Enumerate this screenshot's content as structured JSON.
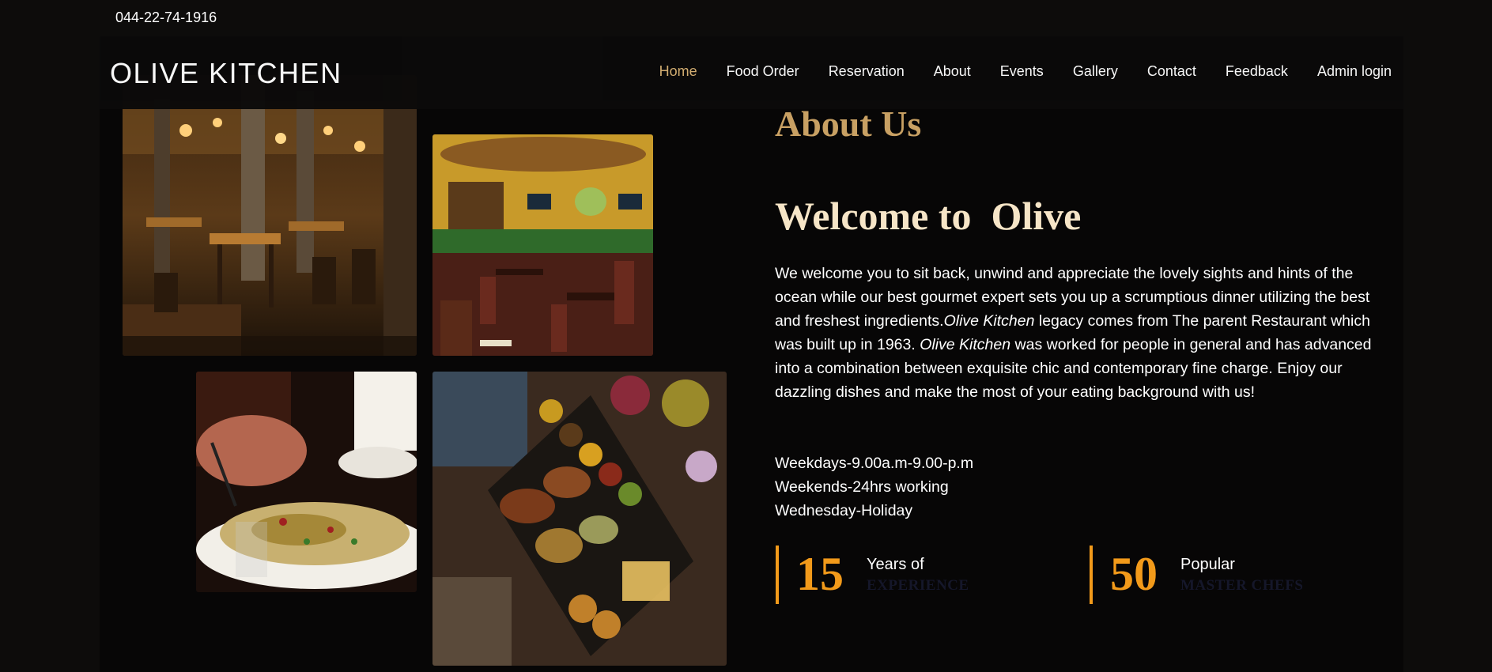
{
  "topbar": {
    "phone": "044-22-74-1916"
  },
  "brand": "OLIVE KITCHEN",
  "nav": {
    "items": [
      "Home",
      "Food Order",
      "Reservation",
      "About",
      "Events",
      "Gallery",
      "Contact",
      "Feedback",
      "Admin login"
    ],
    "active": "Home"
  },
  "about": {
    "title": "About Us",
    "welcome": "Welcome to  Olive",
    "paragraph_parts": [
      "We welcome you to sit back, unwind and appreciate the lovely sights and hints of the ocean while our best gourmet expert sets you up a scrumptious dinner utilizing the best and freshest ingredients.",
      "Olive Kitchen",
      " legacy comes from The parent Restaurant which was built up in 1963. ",
      "Olive Kitchen",
      " was worked for people in general and has advanced into a combination between exquisite chic and contemporary fine charge. Enjoy our dazzling dishes and make the most of your eating background with us!"
    ],
    "hours": [
      "Weekdays-9.00a.m-9.00-p.m",
      "Weekends-24hrs working",
      "Wednesday-Holiday"
    ]
  },
  "stats": [
    {
      "number": "15",
      "line1": "Years of",
      "line2": "EXPERIENCE"
    },
    {
      "number": "50",
      "line1": "Popular",
      "line2": "MASTER CHEFS"
    }
  ],
  "images": [
    "restaurant-interior-photo",
    "restaurant-dining-room-photo",
    "pasta-dish-photo",
    "grill-platter-photo"
  ],
  "colors": {
    "accent": "#c8a063",
    "stat_accent": "#f29a1a",
    "welcome": "#f6e5c7",
    "nav_active": "#d9b375",
    "background": "#070606"
  }
}
